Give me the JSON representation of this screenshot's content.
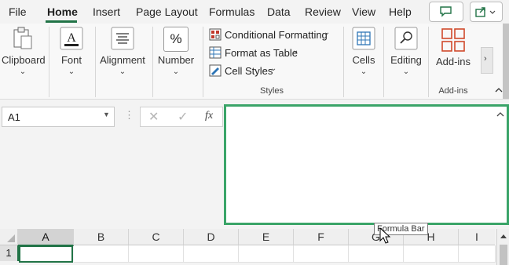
{
  "menu": {
    "tabs": [
      "File",
      "Home",
      "Insert",
      "Page Layout",
      "Formulas",
      "Data",
      "Review",
      "View",
      "Help"
    ],
    "active_tab": "Home"
  },
  "ribbon": {
    "clipboard": "Clipboard",
    "font": "Font",
    "alignment": "Alignment",
    "number": "Number",
    "number_icon": "%",
    "conditional_formatting": "Conditional Formatting",
    "format_as_table": "Format as Table",
    "cell_styles": "Cell Styles",
    "styles_group": "Styles",
    "cells": "Cells",
    "editing": "Editing",
    "addins": "Add-ins",
    "addins_group": "Add-ins"
  },
  "formula_bar": {
    "name_box": "A1",
    "fx": "fx",
    "tooltip": "Formula Bar",
    "value": ""
  },
  "grid": {
    "columns": [
      "A",
      "B",
      "C",
      "D",
      "E",
      "F",
      "G",
      "H",
      "I"
    ],
    "rows": [
      "1"
    ],
    "selected_cell": "A1"
  },
  "colors": {
    "accent": "#217346",
    "highlight_border": "#3aa468"
  },
  "icons": [
    "comment-icon",
    "share-icon",
    "cancel-icon",
    "enter-icon",
    "fx-icon",
    "collapse-icon",
    "scroll-up-icon",
    "mouse-cursor-icon"
  ]
}
